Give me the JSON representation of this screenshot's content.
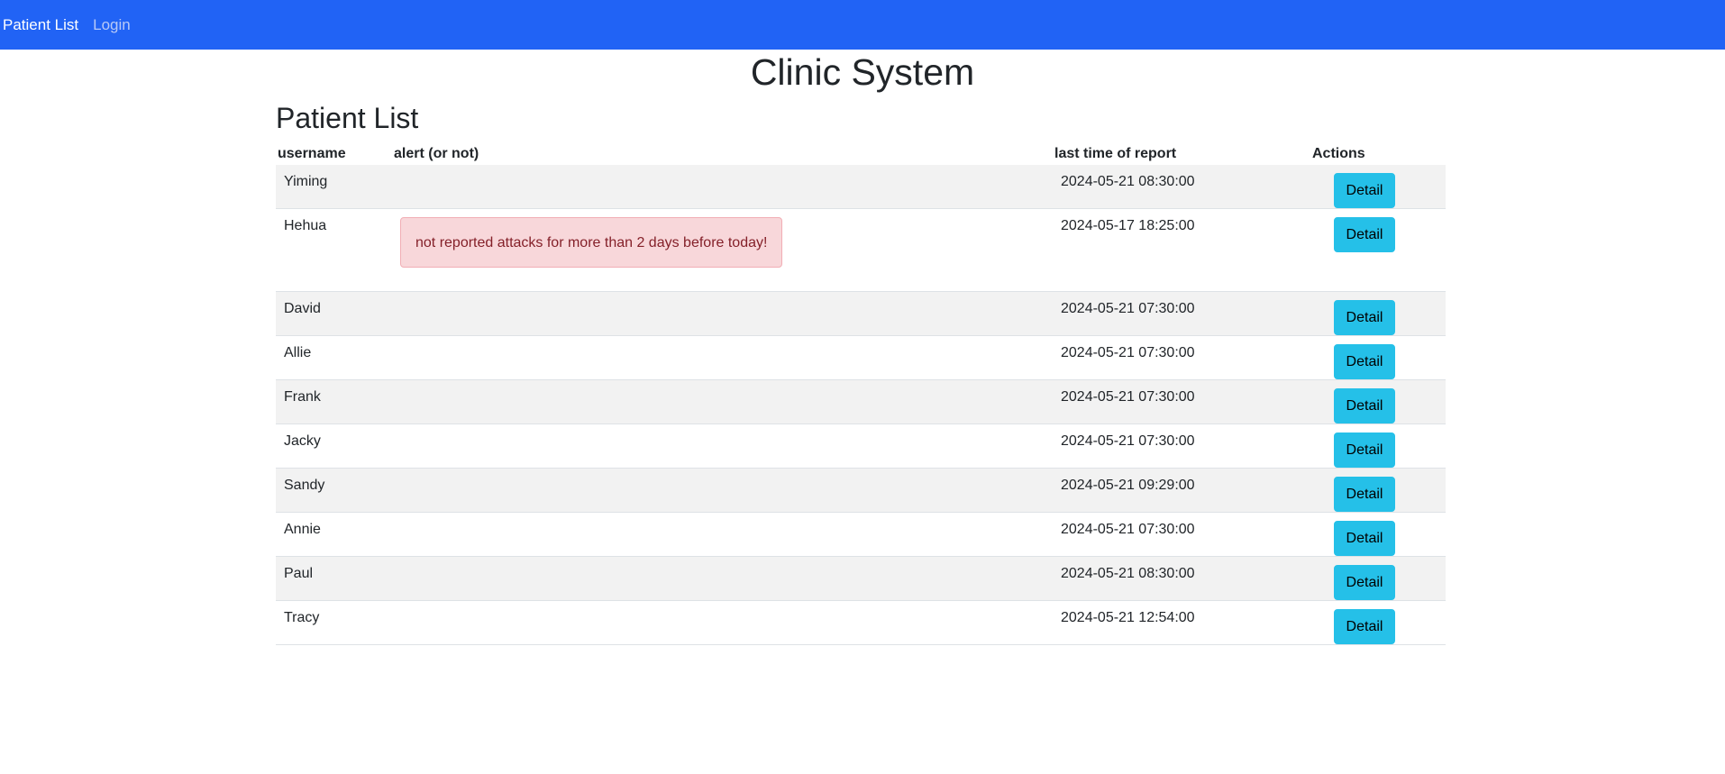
{
  "nav": {
    "links": [
      {
        "label": "Patient List"
      },
      {
        "label": "Login"
      }
    ]
  },
  "site_title": "Clinic System",
  "page_heading": "Patient List",
  "table": {
    "headers": [
      "username",
      "alert (or not)",
      "last time of report",
      "Actions"
    ],
    "rows": [
      {
        "username": "Yiming",
        "alert": "",
        "last_report": "2024-05-21 08:30:00",
        "action": "Detail"
      },
      {
        "username": "Hehua",
        "alert": "not reported attacks for more than 2 days before today!",
        "last_report": "2024-05-17 18:25:00",
        "action": "Detail"
      },
      {
        "username": "David",
        "alert": "",
        "last_report": "2024-05-21 07:30:00",
        "action": "Detail"
      },
      {
        "username": "Allie",
        "alert": "",
        "last_report": "2024-05-21 07:30:00",
        "action": "Detail"
      },
      {
        "username": "Frank",
        "alert": "",
        "last_report": "2024-05-21 07:30:00",
        "action": "Detail"
      },
      {
        "username": "Jacky",
        "alert": "",
        "last_report": "2024-05-21 07:30:00",
        "action": "Detail"
      },
      {
        "username": "Sandy",
        "alert": "",
        "last_report": "2024-05-21 09:29:00",
        "action": "Detail"
      },
      {
        "username": "Annie",
        "alert": "",
        "last_report": "2024-05-21 07:30:00",
        "action": "Detail"
      },
      {
        "username": "Paul",
        "alert": "",
        "last_report": "2024-05-21 08:30:00",
        "action": "Detail"
      },
      {
        "username": "Tracy",
        "alert": "",
        "last_report": "2024-05-21 12:54:00",
        "action": "Detail"
      }
    ]
  },
  "colors": {
    "navbar": "#2163f5",
    "alert_bg": "#f8d7da",
    "alert_text": "#842029",
    "button": "#25c0e8",
    "row_stripe": "#f2f2f2"
  }
}
